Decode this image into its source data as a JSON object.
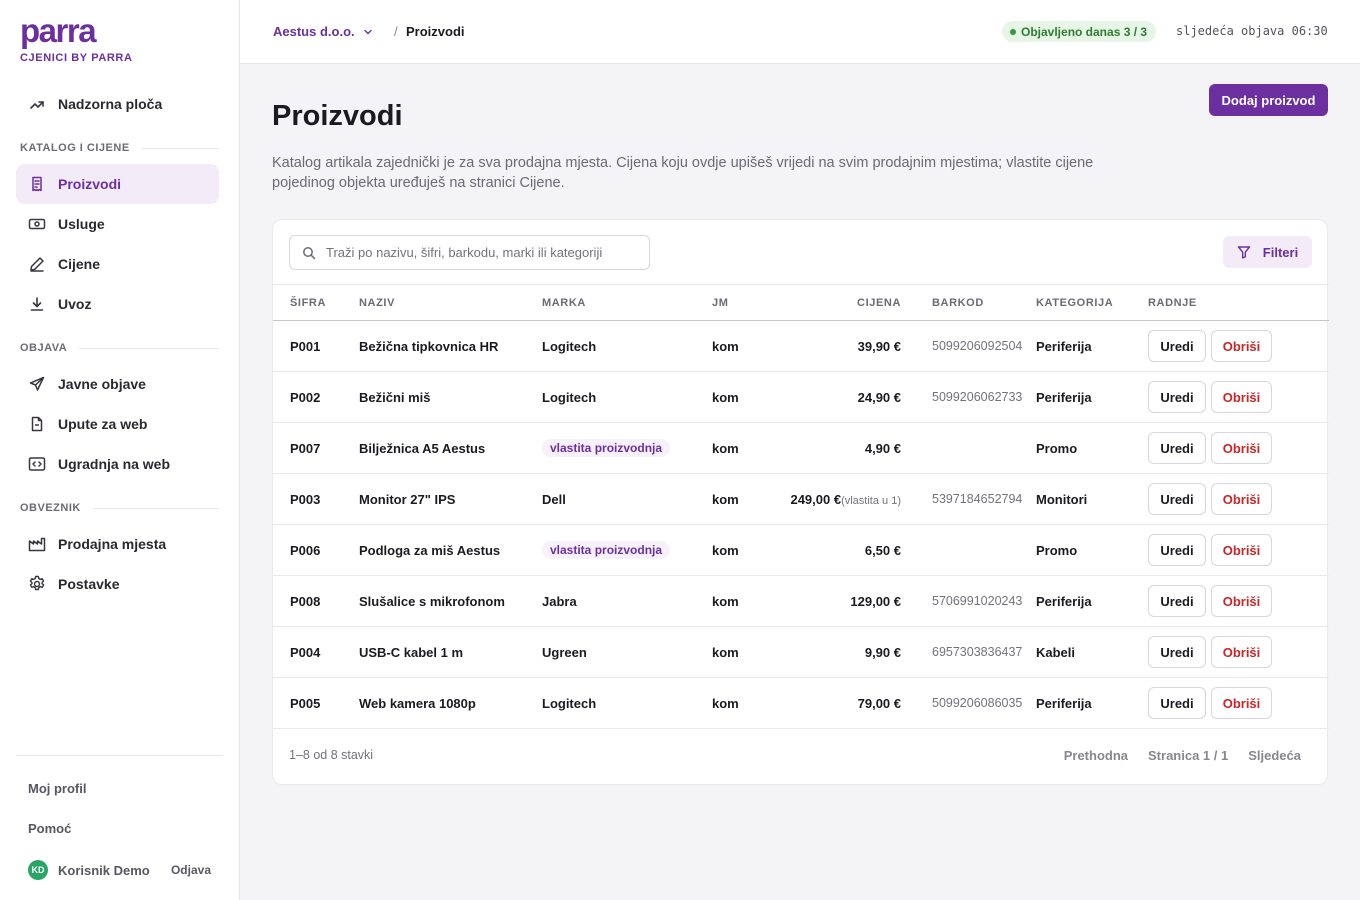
{
  "brand": {
    "logo": "parra",
    "subtitle": "CJENICI BY PARRA"
  },
  "nav": {
    "dashboard": "Nadzorna ploča",
    "section_catalog": "KATALOG I CIJENE",
    "products": "Proizvodi",
    "services": "Usluge",
    "prices": "Cijene",
    "import": "Uvoz",
    "section_publish": "OBJAVA",
    "public_posts": "Javne objave",
    "web_guide": "Upute za web",
    "web_embed": "Ugradnja na web",
    "section_obligor": "OBVEZNIK",
    "points_of_sale": "Prodajna mjesta",
    "settings": "Postavke"
  },
  "sidebar_bottom": {
    "profile": "Moj profil",
    "help": "Pomoć",
    "user_initials": "KD",
    "user_name": "Korisnik Demo",
    "logout": "Odjava"
  },
  "topbar": {
    "company": "Aestus d.o.o.",
    "separator": "/",
    "current": "Proizvodi",
    "published_badge": "Objavljeno danas 3 / 3",
    "next_post": "sljedeća objava 06:30"
  },
  "page": {
    "title": "Proizvodi",
    "add_button": "Dodaj proizvod",
    "description": "Katalog artikala zajednički je za sva prodajna mjesta. Cijena koju ovdje upišeš vrijedi na svim prodajnim mjestima; vlastite cijene pojedinog objekta uređuješ na stranici Cijene."
  },
  "toolbar": {
    "search_placeholder": "Traži po nazivu, šifri, barkodu, marki ili kategoriji",
    "filters": "Filteri"
  },
  "table": {
    "headers": [
      "ŠIFRA",
      "NAZIV",
      "MARKA",
      "JM",
      "CIJENA",
      "BARKOD",
      "KATEGORIJA",
      "RADNJE"
    ],
    "edit_label": "Uredi",
    "delete_label": "Obriši",
    "rows": [
      {
        "code": "P001",
        "name": "Bežična tipkovnica HR",
        "brand": "Logitech",
        "own": false,
        "unit": "kom",
        "price": "39,90 €",
        "note": "",
        "barcode": "5099206092504",
        "category": "Periferija"
      },
      {
        "code": "P002",
        "name": "Bežični miš",
        "brand": "Logitech",
        "own": false,
        "unit": "kom",
        "price": "24,90 €",
        "note": "",
        "barcode": "5099206062733",
        "category": "Periferija"
      },
      {
        "code": "P007",
        "name": "Bilježnica A5 Aestus",
        "brand": "vlastita proizvodnja",
        "own": true,
        "unit": "kom",
        "price": "4,90 €",
        "note": "",
        "barcode": "",
        "category": "Promo"
      },
      {
        "code": "P003",
        "name": "Monitor 27\" IPS",
        "brand": "Dell",
        "own": false,
        "unit": "kom",
        "price": "249,00 €",
        "note": "(vlastita u 1)",
        "barcode": "5397184652794",
        "category": "Monitori"
      },
      {
        "code": "P006",
        "name": "Podloga za miš Aestus",
        "brand": "vlastita proizvodnja",
        "own": true,
        "unit": "kom",
        "price": "6,50 €",
        "note": "",
        "barcode": "",
        "category": "Promo"
      },
      {
        "code": "P008",
        "name": "Slušalice s mikrofonom",
        "brand": "Jabra",
        "own": false,
        "unit": "kom",
        "price": "129,00 €",
        "note": "",
        "barcode": "5706991020243",
        "category": "Periferija"
      },
      {
        "code": "P004",
        "name": "USB-C kabel 1 m",
        "brand": "Ugreen",
        "own": false,
        "unit": "kom",
        "price": "9,90 €",
        "note": "",
        "barcode": "6957303836437",
        "category": "Kabeli"
      },
      {
        "code": "P005",
        "name": "Web kamera 1080p",
        "brand": "Logitech",
        "own": false,
        "unit": "kom",
        "price": "79,00 €",
        "note": "",
        "barcode": "5099206086035",
        "category": "Periferija"
      }
    ]
  },
  "pagination": {
    "range": "1–8 od 8 stavki",
    "prev": "Prethodna",
    "page_info": "Stranica 1 / 1",
    "next": "Sljedeća"
  },
  "colors": {
    "brand_purple": "#6b2fa0",
    "active_bg": "#f3ecf8",
    "danger": "#c62828",
    "success": "#2e7d32",
    "avatar_green": "#2aa565"
  },
  "icons": {
    "dashboard": "trend-up-icon",
    "products": "receipt-icon",
    "services": "banknote-icon",
    "prices": "pencil-icon",
    "import": "download-icon",
    "public_posts": "send-icon",
    "web_guide": "document-icon",
    "web_embed": "code-icon",
    "points_of_sale": "factory-icon",
    "settings": "gear-icon",
    "search": "search-icon",
    "filter": "filter-icon",
    "dropdown": "chevron-down-icon"
  }
}
